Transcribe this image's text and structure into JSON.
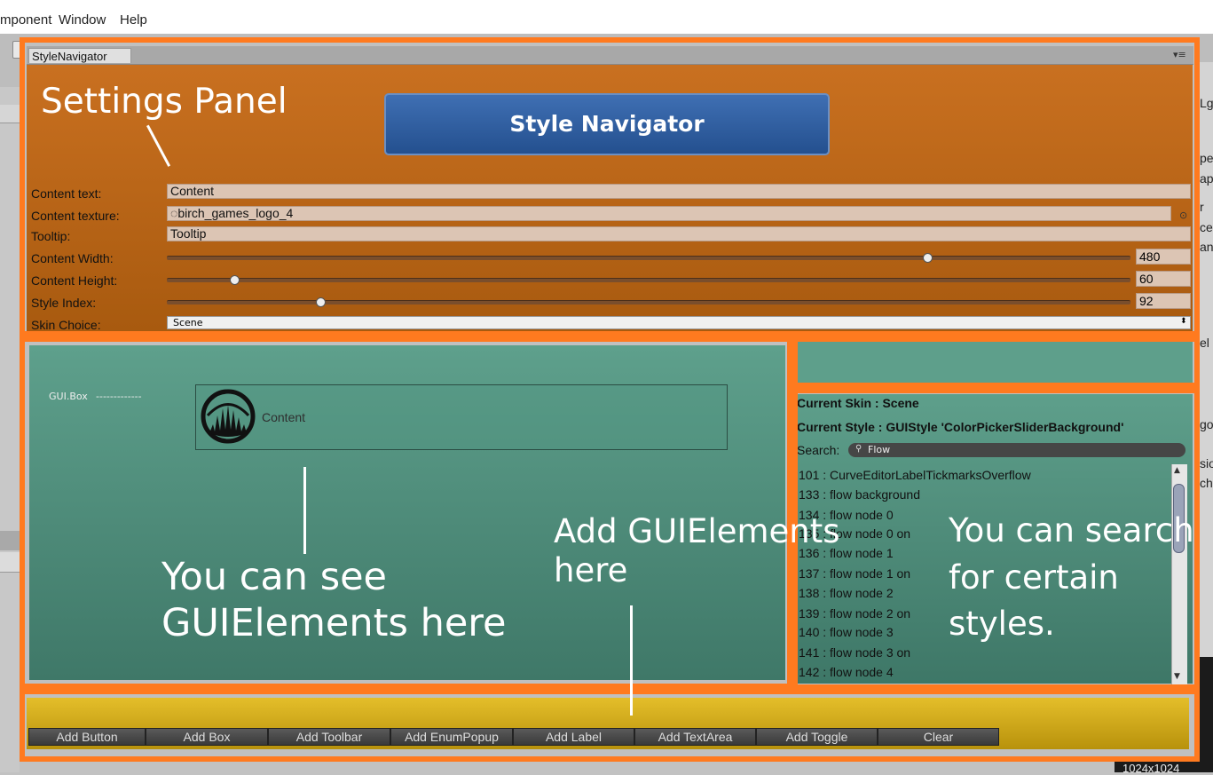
{
  "menu": {
    "component": "mponent",
    "window": "Window",
    "help": "Help"
  },
  "window": {
    "tab_label": "StyleNavigator",
    "tab_menu_icon": "menu-icon"
  },
  "header": {
    "title_button": "Style Navigator"
  },
  "settings": {
    "content_text_label": "Content text:",
    "content_text_value": "Content",
    "content_texture_label": "Content texture:",
    "content_texture_value": "birch_games_logo_4",
    "tooltip_label": "Tooltip:",
    "tooltip_value": "Tooltip",
    "content_width_label": "Content Width:",
    "content_width_value": "480",
    "content_width_fraction": 0.79,
    "content_height_label": "Content Height:",
    "content_height_value": "60",
    "content_height_fraction": 0.07,
    "style_index_label": "Style Index:",
    "style_index_value": "92",
    "style_index_fraction": 0.16,
    "skin_choice_label": "Skin Choice:",
    "skin_choice_value": "Scene"
  },
  "preview": {
    "guibox_label": "GUI.Box",
    "guibox_dashes": "-------------",
    "content_text": "Content"
  },
  "styles": {
    "current_skin": "Current Skin : Scene",
    "current_style": "Current Style : GUIStyle 'ColorPickerSliderBackground'",
    "search_label": "Search:",
    "search_value": "Flow",
    "items": [
      "101 : CurveEditorLabelTickmarksOverflow",
      "133 : flow background",
      "134 : flow node 0",
      "135 : flow node 0 on",
      "136 : flow node 1",
      "137 : flow node 1 on",
      "138 : flow node 2",
      "139 : flow node 2 on",
      "140 : flow node 3",
      "141 : flow node 3 on",
      "142 : flow node 4"
    ]
  },
  "buttons": [
    "Add Button",
    "Add Box",
    "Add Toolbar",
    "Add EnumPopup",
    "Add Label",
    "Add TextArea",
    "Add Toggle",
    "Clear"
  ],
  "annotations": {
    "settings_panel": "Settings Panel",
    "see_elements_1": "You can see",
    "see_elements_2": "GUIElements here",
    "add_elements_1": "Add GUIElements",
    "add_elements_2": "here",
    "search_1": "You can search",
    "search_2": "for certain",
    "search_3": "styles."
  },
  "background": {
    "right_texts": [
      "Lg",
      "pe",
      "ap",
      "r",
      "ce",
      "an",
      "el",
      "gor",
      "sion",
      "ch"
    ],
    "corner_text": "1024x1024"
  },
  "colors": {
    "annotation_orange": "#ff7a1f",
    "settings_bg": "#c97020",
    "preview_bg": "#5ea08c",
    "button_bar_bg": "#e4be2a",
    "title_button_bg": "#3f6fb3"
  }
}
